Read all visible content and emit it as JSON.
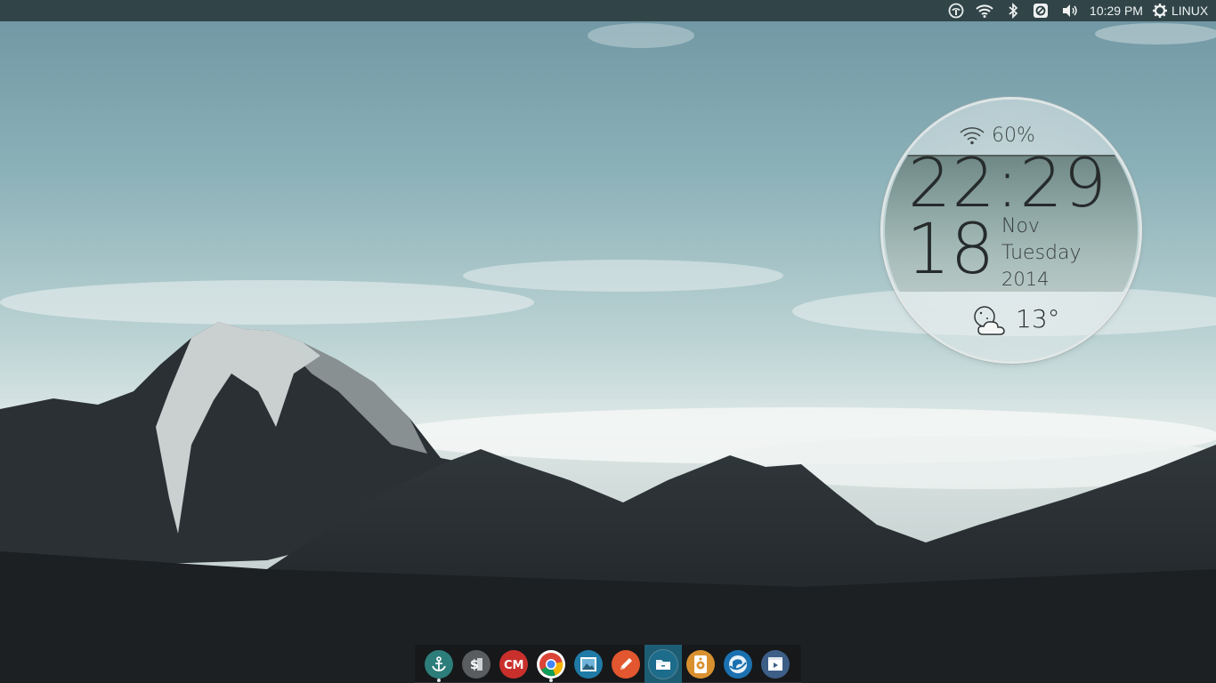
{
  "top_panel": {
    "indicators": [
      {
        "icon": "update-indicator-icon"
      },
      {
        "icon": "wifi-icon"
      },
      {
        "icon": "bluetooth-icon"
      },
      {
        "icon": "notification-blocked-icon"
      },
      {
        "icon": "volume-icon"
      }
    ],
    "clock": "10:29 PM",
    "session_icon": "gear-icon",
    "session_label": "LINUX"
  },
  "widget": {
    "wifi_icon": "wifi-icon",
    "wifi_percent": "60%",
    "time": "22:29",
    "day": "18",
    "month": "Nov",
    "weekday": "Tuesday",
    "year": "2014",
    "weather_icon": "partly-cloudy-night-icon",
    "temperature": "13°"
  },
  "dock": {
    "items": [
      {
        "name": "anchor-app",
        "icon": "anchor-icon",
        "color": "#2d7d7a",
        "running": true
      },
      {
        "name": "terminal-app",
        "icon": "terminal-dollar-icon",
        "color": "#5a5d60",
        "running": false
      },
      {
        "name": "cm-app",
        "icon": "cm-icon",
        "color": "#c9302c",
        "running": false
      },
      {
        "name": "chrome-browser",
        "icon": "chrome-icon",
        "color": "#ffffff",
        "running": true
      },
      {
        "name": "image-viewer",
        "icon": "image-icon",
        "color": "#1f7aa6",
        "running": false
      },
      {
        "name": "text-editor",
        "icon": "pencil-icon",
        "color": "#e2572f",
        "running": false
      },
      {
        "name": "file-manager",
        "icon": "folder-icon",
        "color": "#1d6c8c",
        "running": false
      },
      {
        "name": "speaker-app",
        "icon": "speaker-icon",
        "color": "#d9912f",
        "running": false
      },
      {
        "name": "browser-globe",
        "icon": "globe-icon",
        "color": "#1b71b0",
        "running": false
      },
      {
        "name": "video-player",
        "icon": "video-icon",
        "color": "#3d5e86",
        "running": false
      }
    ]
  }
}
